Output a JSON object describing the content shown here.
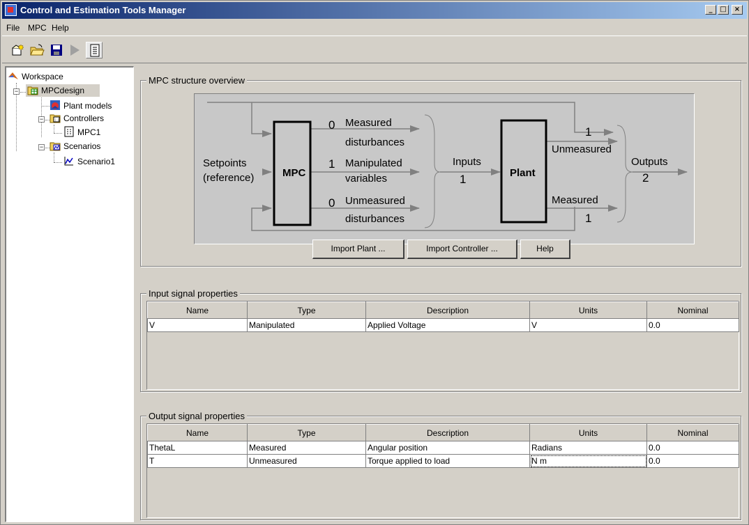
{
  "window": {
    "title": "Control and Estimation Tools Manager"
  },
  "menu": [
    "File",
    "MPC",
    "Help"
  ],
  "tree": {
    "workspace": "Workspace",
    "mpcdesign": "MPCdesign",
    "plant_models": "Plant models",
    "controllers": "Controllers",
    "mpc1": "MPC1",
    "scenarios": "Scenarios",
    "scenario1": "Scenario1"
  },
  "overview": {
    "title": "MPC structure overview",
    "setpoints": "Setpoints",
    "reference": "(reference)",
    "mpc": "MPC",
    "plant": "Plant",
    "md_count": "0",
    "md_label1": "Measured",
    "md_label2": "disturbances",
    "mv_count": "1",
    "mv_label1": "Manipulated",
    "mv_label2": "variables",
    "ud_count": "0",
    "ud_label1": "Unmeasured",
    "ud_label2": "disturbances",
    "inputs_label": "Inputs",
    "inputs_count": "1",
    "unmeasured_count": "1",
    "unmeasured_label": "Unmeasured",
    "measured_label": "Measured",
    "measured_count": "1",
    "outputs_label": "Outputs",
    "outputs_count": "2"
  },
  "buttons": {
    "import_plant": "Import Plant ...",
    "import_controller": "Import Controller ...",
    "help": "Help"
  },
  "input_signals": {
    "title": "Input signal properties",
    "columns": [
      "Name",
      "Type",
      "Description",
      "Units",
      "Nominal"
    ],
    "rows": [
      [
        "V",
        "Manipulated",
        "Applied Voltage",
        "V",
        "0.0"
      ]
    ]
  },
  "output_signals": {
    "title": "Output signal properties",
    "columns": [
      "Name",
      "Type",
      "Description",
      "Units",
      "Nominal"
    ],
    "rows": [
      [
        "ThetaL",
        "Measured",
        "Angular position",
        "Radians",
        "0.0"
      ],
      [
        "T",
        "Unmeasured",
        "Torque applied to load",
        "N m",
        "0.0"
      ]
    ]
  }
}
